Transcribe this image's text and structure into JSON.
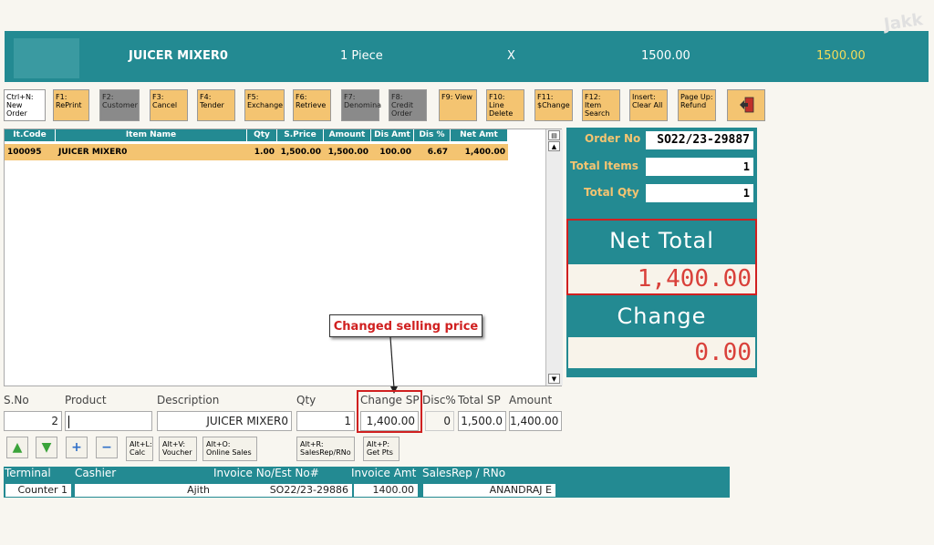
{
  "topbar": {
    "item": "JUICER MIXER0",
    "unit": "1 Piece",
    "x": "X",
    "price": "1500.00",
    "total": "1500.00"
  },
  "watermark": "Jakk",
  "fkeys": [
    {
      "label": "Ctrl+N: New Order"
    },
    {
      "label": "F1: RePrint"
    },
    {
      "label": "F2: Customer"
    },
    {
      "label": "F3: Cancel"
    },
    {
      "label": "F4: Tender"
    },
    {
      "label": "F5: Exchange"
    },
    {
      "label": "F6: Retrieve"
    },
    {
      "label": "F7: Denomina"
    },
    {
      "label": "F8: Credit Order"
    },
    {
      "label": "F9: View"
    },
    {
      "label": "F10: Line Delete"
    },
    {
      "label": "F11: $Change"
    },
    {
      "label": "F12: Item Search"
    },
    {
      "label": "Insert: Clear All"
    },
    {
      "label": "Page Up: Refund"
    }
  ],
  "grid": {
    "headers": [
      "It.Code",
      "Item Name",
      "Qty",
      "S.Price",
      "Amount",
      "Dis Amt",
      "Dis %",
      "Net Amt"
    ],
    "row": [
      "100095",
      "JUICER MIXER0",
      "1.00",
      "1,500.00",
      "1,500.00",
      "100.00",
      "6.67",
      "1,400.00"
    ]
  },
  "panel": {
    "order_no_label": "Order No",
    "order_no": "SO22/23-29887",
    "total_items_label": "Total Items",
    "total_items": "1",
    "total_qty_label": "Total Qty",
    "total_qty": "1",
    "net_total_label": "Net Total",
    "net_total": "1,400.00",
    "change_label": "Change",
    "change": "0.00"
  },
  "callout": "Changed selling price",
  "entry": {
    "labels": [
      "S.No",
      "Product",
      "Description",
      "Qty",
      "Change SP",
      "Disc%",
      "Total SP",
      "Amount"
    ],
    "sno": "2",
    "product": "",
    "description": "JUICER MIXER0",
    "qty": "1",
    "change_sp": "1,400.00",
    "disc": "0",
    "total_sp": "1,500.0",
    "amount": "1,400.00"
  },
  "buttons": {
    "calc": "Alt+L: Calc",
    "voucher": "Alt+V: Voucher",
    "online": "Alt+O: Online Sales",
    "salesrep": "Alt+R: SalesRep/RNo",
    "getpts": "Alt+P: Get Pts"
  },
  "status": {
    "labels": [
      "Terminal",
      "Cashier",
      "Invoice No/Est No#",
      "Invoice Amt",
      "SalesRep / RNo"
    ],
    "terminal": "Counter 1",
    "cashier": "Ajith",
    "invoice_no": "SO22/23-29886",
    "invoice_amt": "1400.00",
    "salesrep": "ANANDRAJ E"
  },
  "colors": {
    "teal": "#238a92",
    "amber": "#f4c471",
    "red": "#d9403a"
  }
}
